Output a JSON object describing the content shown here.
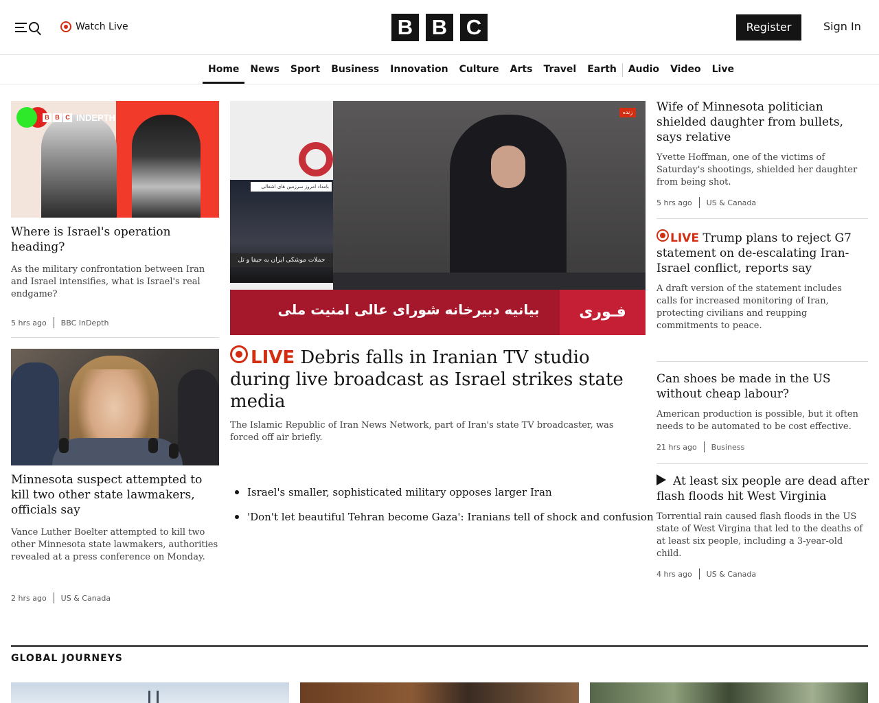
{
  "header": {
    "watch_live": "Watch Live",
    "logo_letters": [
      "B",
      "B",
      "C"
    ],
    "register": "Register",
    "sign_in": "Sign In"
  },
  "nav": {
    "items": [
      "Home",
      "News",
      "Sport",
      "Business",
      "Innovation",
      "Culture",
      "Arts",
      "Travel",
      "Earth",
      "Audio",
      "Video",
      "Live"
    ],
    "active": "Home"
  },
  "left": {
    "story1": {
      "image_badge": "INDEPTH",
      "image_logo": [
        "B",
        "B",
        "C"
      ],
      "headline": "Where is Israel's operation heading?",
      "summary": "As the military confrontation between Iran and Israel intensifies, what is Israel's real endgame?",
      "time": "5 hrs ago",
      "section": "BBC InDepth"
    },
    "story2": {
      "headline": "Minnesota suspect attempted to kill two other state lawmakers, officials say",
      "summary": "Vance Luther Boelter attempted to kill two other Minnesota state lawmakers, authorities revealed at a press conference on Monday.",
      "time": "2 hrs ago",
      "section": "US & Canada"
    }
  },
  "hero": {
    "image_lower_third": "بیانیه دبیرخانه شورای عالی امنیت ملی",
    "image_brand": "فـوری",
    "image_live_tag": "زنده",
    "image_city_caption": "حملات موشکی ایران به حیفا و تل",
    "image_city_strip": "بامداد امروز  سرزمین های اشغالی",
    "live_label": "LIVE",
    "headline": "Debris falls in Iranian TV studio during live broadcast as Israel strikes state media",
    "summary": "The Islamic Republic of Iran News Network, part of Iran's state TV broadcaster, was forced off air briefly.",
    "related": [
      "Israel's smaller, sophisticated military opposes larger Iran",
      "'Don't let beautiful Tehran become Gaza': Iranians tell of shock and confusion"
    ]
  },
  "right": {
    "story1": {
      "headline": "Wife of Minnesota politician shielded daughter from bullets, says relative",
      "summary": "Yvette Hoffman, one of the victims of Saturday's shootings, shielded her daughter from being shot.",
      "time": "5 hrs ago",
      "section": "US & Canada"
    },
    "story2": {
      "live_label": "LIVE",
      "headline": "Trump plans to reject G7 statement on de-escalating Iran-Israel conflict, reports say",
      "summary": "A draft version of the statement includes calls for increased monitoring of Iran, protecting civilians and reupping commitments to peace."
    },
    "story3": {
      "headline": "Can shoes be made in the US without cheap labour?",
      "summary": "American production is possible, but it often needs to be automated to be cost effective.",
      "time": "21 hrs ago",
      "section": "Business"
    },
    "story4": {
      "headline": "At least six people are dead after flash floods hit West Virginia",
      "summary": "Torrential rain caused flash floods in the US state of West Virgina that led to the deaths of at least six people, including a 3-year-old child.",
      "time": "4 hrs ago",
      "section": "US & Canada"
    }
  },
  "global_journeys": {
    "title": "GLOBAL JOURNEYS"
  }
}
